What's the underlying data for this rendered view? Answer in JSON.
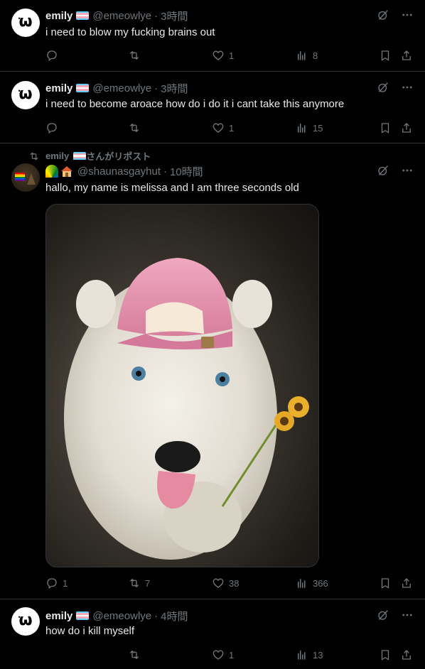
{
  "posts": [
    {
      "name": "emily",
      "handle": "@emeowlye",
      "time": "3時間",
      "text": "i need to blow my fucking brains out",
      "stats": {
        "reply": "",
        "repost": "",
        "like": "1",
        "views": "8"
      }
    },
    {
      "name": "emily",
      "handle": "@emeowlye",
      "time": "3時間",
      "text": "i need to become aroace how do i do it i cant take this anymore",
      "stats": {
        "reply": "",
        "repost": "",
        "like": "1",
        "views": "15"
      }
    },
    {
      "repost_label": "emily",
      "repost_suffix": "さんがリポスト",
      "handle": "@shaunasgayhut",
      "time": "10時間",
      "text": "hallo, my name is melissa and I am three seconds old",
      "stats": {
        "reply": "1",
        "repost": "7",
        "like": "38",
        "views": "366"
      }
    },
    {
      "name": "emily",
      "handle": "@emeowlye",
      "time": "4時間",
      "text": "how do i kill myself",
      "stats": {
        "reply": "",
        "repost": "",
        "like": "1",
        "views": "13"
      }
    }
  ],
  "flag_colors": [
    "#5BCEFA",
    "#F5A9B8",
    "#FFFFFF",
    "#F5A9B8",
    "#5BCEFA"
  ],
  "colors": {
    "text": "#e7e9ea",
    "muted": "#71767b",
    "border": "#2f3336",
    "background": "#000000",
    "cap": "#e89ab0"
  },
  "icons": [
    "reply-icon",
    "repost-icon",
    "like-icon",
    "views-icon",
    "bookmark-icon",
    "share-icon",
    "grok-icon",
    "more-icon"
  ]
}
